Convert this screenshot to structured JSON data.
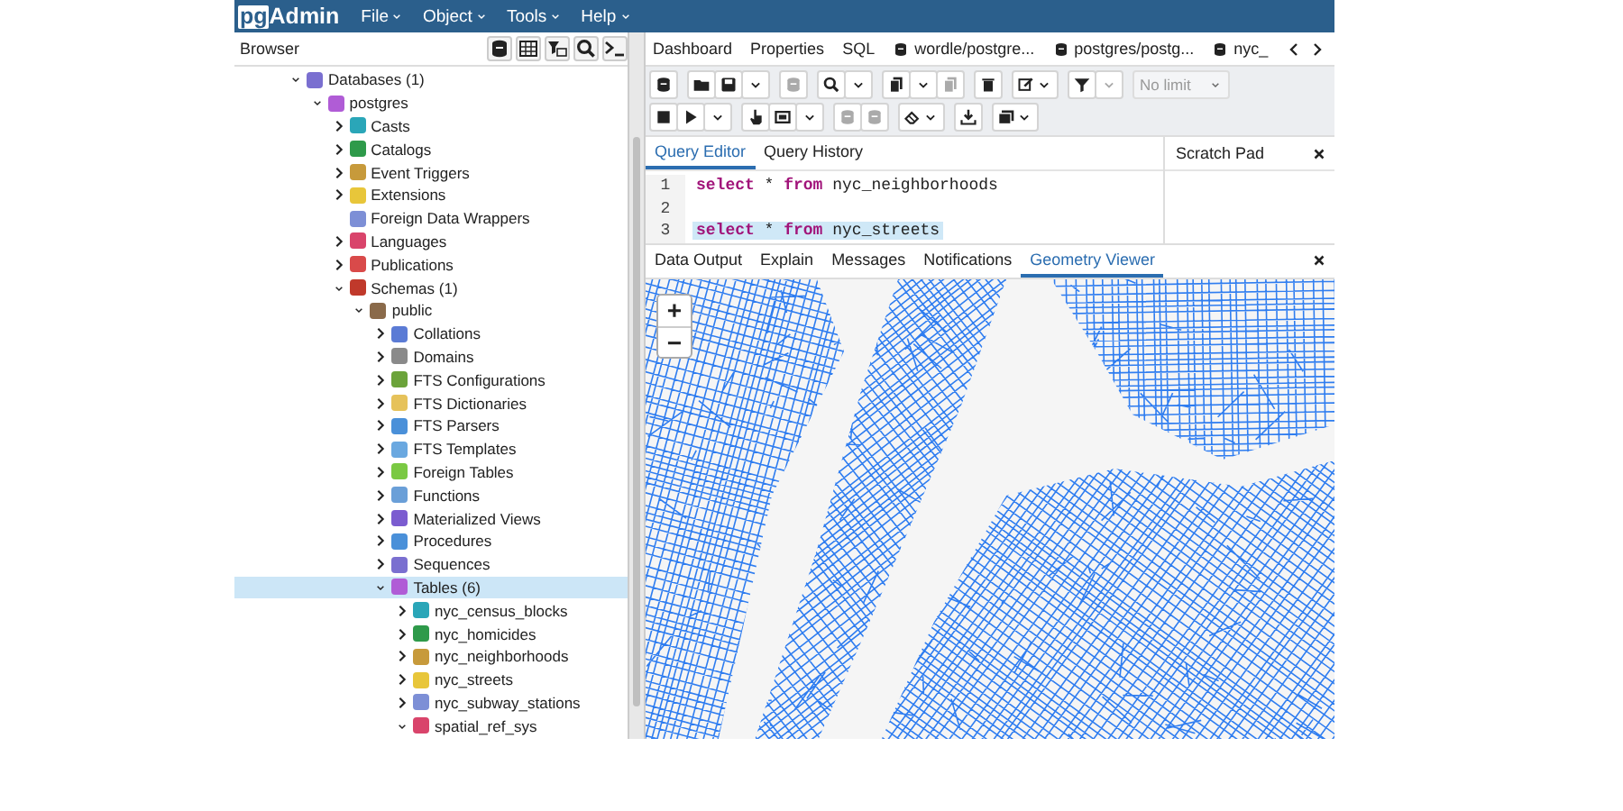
{
  "header": {
    "logo": {
      "prefix": "pg",
      "name": "Admin"
    },
    "menus": [
      "File",
      "Object",
      "Tools",
      "Help"
    ]
  },
  "browser": {
    "title": "Browser"
  },
  "tree": [
    {
      "label": "Databases (1)",
      "kind": "branch",
      "expanded": true,
      "selected": false,
      "children": [
        {
          "label": "postgres",
          "kind": "branch",
          "expanded": true,
          "selected": false,
          "children": [
            {
              "label": "Casts",
              "kind": "branch",
              "expanded": false,
              "selected": false
            },
            {
              "label": "Catalogs",
              "kind": "branch",
              "expanded": false,
              "selected": false
            },
            {
              "label": "Event Triggers",
              "kind": "branch",
              "expanded": false,
              "selected": false
            },
            {
              "label": "Extensions",
              "kind": "branch",
              "expanded": false,
              "selected": false
            },
            {
              "label": "Foreign Data Wrappers",
              "kind": "leaf",
              "selected": false
            },
            {
              "label": "Languages",
              "kind": "branch",
              "expanded": false,
              "selected": false
            },
            {
              "label": "Publications",
              "kind": "branch",
              "expanded": false,
              "selected": false
            },
            {
              "label": "Schemas (1)",
              "kind": "branch",
              "expanded": true,
              "selected": false,
              "children": [
                {
                  "label": "public",
                  "kind": "branch",
                  "expanded": true,
                  "selected": false,
                  "children": [
                    {
                      "label": "Collations",
                      "kind": "branch",
                      "expanded": false,
                      "selected": false
                    },
                    {
                      "label": "Domains",
                      "kind": "branch",
                      "expanded": false,
                      "selected": false
                    },
                    {
                      "label": "FTS Configurations",
                      "kind": "branch",
                      "expanded": false,
                      "selected": false
                    },
                    {
                      "label": "FTS Dictionaries",
                      "kind": "branch",
                      "expanded": false,
                      "selected": false
                    },
                    {
                      "label": "FTS Parsers",
                      "kind": "branch",
                      "expanded": false,
                      "selected": false
                    },
                    {
                      "label": "FTS Templates",
                      "kind": "branch",
                      "expanded": false,
                      "selected": false
                    },
                    {
                      "label": "Foreign Tables",
                      "kind": "branch",
                      "expanded": false,
                      "selected": false
                    },
                    {
                      "label": "Functions",
                      "kind": "branch",
                      "expanded": false,
                      "selected": false
                    },
                    {
                      "label": "Materialized Views",
                      "kind": "branch",
                      "expanded": false,
                      "selected": false
                    },
                    {
                      "label": "Procedures",
                      "kind": "branch",
                      "expanded": false,
                      "selected": false
                    },
                    {
                      "label": "Sequences",
                      "kind": "branch",
                      "expanded": false,
                      "selected": false
                    },
                    {
                      "label": "Tables (6)",
                      "kind": "branch",
                      "expanded": true,
                      "selected": true,
                      "children": [
                        {
                          "label": "nyc_census_blocks",
                          "kind": "branch",
                          "expanded": false,
                          "selected": false
                        },
                        {
                          "label": "nyc_homicides",
                          "kind": "branch",
                          "expanded": false,
                          "selected": false
                        },
                        {
                          "label": "nyc_neighborhoods",
                          "kind": "branch",
                          "expanded": false,
                          "selected": false
                        },
                        {
                          "label": "nyc_streets",
                          "kind": "branch",
                          "expanded": false,
                          "selected": false
                        },
                        {
                          "label": "nyc_subway_stations",
                          "kind": "branch",
                          "expanded": false,
                          "selected": false
                        },
                        {
                          "label": "spatial_ref_sys",
                          "kind": "branch",
                          "expanded": true,
                          "selected": false
                        }
                      ]
                    }
                  ]
                }
              ]
            }
          ]
        }
      ]
    }
  ],
  "tabs": [
    {
      "label": "Dashboard",
      "kind": "plain"
    },
    {
      "label": "Properties",
      "kind": "plain"
    },
    {
      "label": "SQL",
      "kind": "plain"
    },
    {
      "label": "wordle/postgre...",
      "kind": "query"
    },
    {
      "label": "postgres/postg...",
      "kind": "query"
    },
    {
      "label": "nyc_",
      "kind": "query"
    }
  ],
  "toolbar": {
    "rows": [
      [
        [
          {
            "disabled": false
          }
        ],
        [
          {
            "disabled": false
          },
          {
            "disabled": false
          },
          {
            "disabled": false
          }
        ],
        [
          {
            "disabled": true
          }
        ],
        [
          {
            "disabled": false
          },
          {
            "disabled": false
          }
        ],
        [
          {
            "disabled": false
          },
          {
            "disabled": false
          },
          {
            "disabled": true
          }
        ],
        [
          {
            "disabled": false
          }
        ],
        [
          {
            "disabled": false
          }
        ],
        [
          {
            "disabled": false
          },
          {
            "disabled": true
          }
        ]
      ],
      [
        [
          {
            "disabled": false
          },
          {
            "disabled": false
          },
          {
            "disabled": false
          }
        ],
        [
          {
            "disabled": false
          },
          {
            "disabled": false
          },
          {
            "disabled": false
          }
        ],
        [
          {
            "disabled": true
          },
          {
            "disabled": true
          }
        ],
        [
          {
            "disabled": false
          }
        ],
        [
          {
            "disabled": false
          }
        ],
        [
          {
            "disabled": false
          }
        ]
      ]
    ],
    "limit": {
      "value": "No limit",
      "disabled": true
    }
  },
  "editor_tabs": [
    {
      "label": "Query Editor",
      "selected": true
    },
    {
      "label": "Query History",
      "selected": false
    }
  ],
  "scratch_pad": {
    "title": "Scratch Pad"
  },
  "editor_lines": [
    {
      "number": "1",
      "code": "**select** * **from** nyc_neighborhoods",
      "selected": false
    },
    {
      "number": "2",
      "selected": false
    },
    {
      "number": "3",
      "code": "**select** * **from** nyc_streets",
      "selected": true
    }
  ],
  "result_tabs": [
    {
      "label": "Data Output",
      "selected": false
    },
    {
      "label": "Explain",
      "selected": false
    },
    {
      "label": "Messages",
      "selected": false
    },
    {
      "label": "Notifications",
      "selected": false
    },
    {
      "label": "Geometry Viewer",
      "selected": true
    }
  ],
  "map": {
    "zoom_in": "+",
    "zoom_out": "−"
  }
}
